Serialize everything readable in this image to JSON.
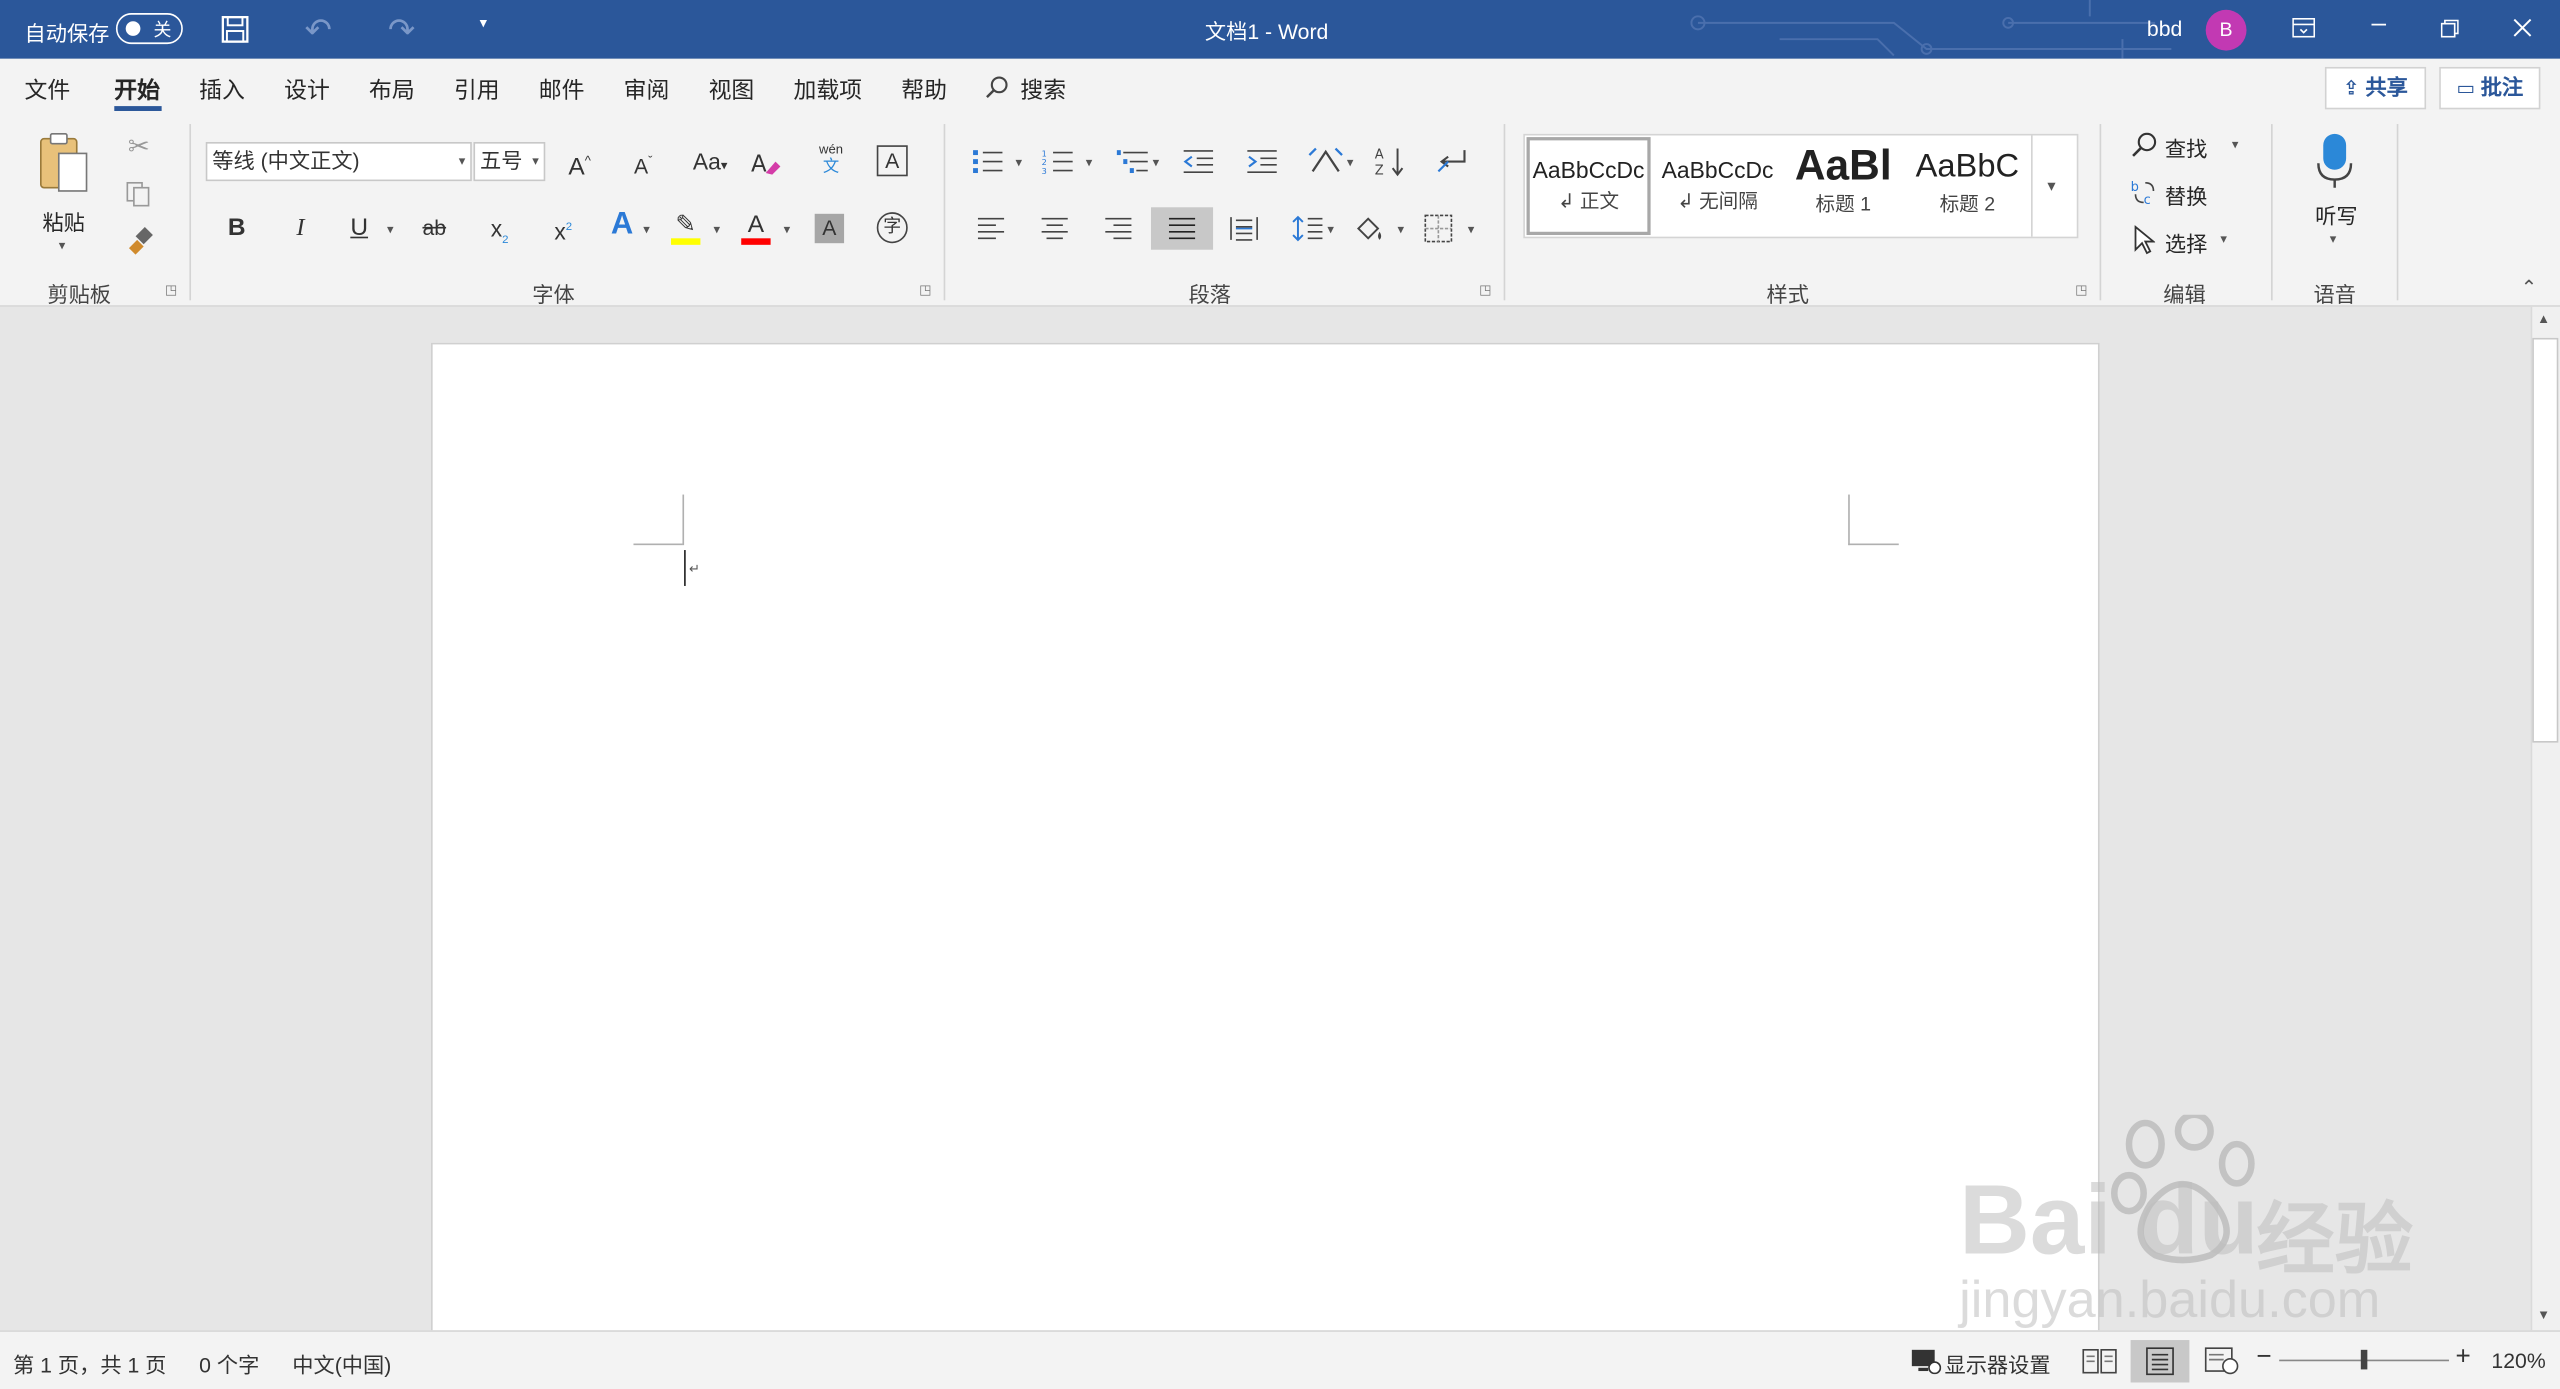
{
  "titlebar": {
    "autosave_label": "自动保存",
    "autosave_state": "关",
    "doc_title": "文档1  -  Word",
    "user_name": "bbd",
    "avatar_initial": "B",
    "icons": [
      "save-icon",
      "undo-icon",
      "redo-icon",
      "customize-qat-icon",
      "ribbon-display-icon",
      "minimize-icon",
      "restore-icon",
      "close-icon"
    ]
  },
  "tabs": {
    "items": [
      "文件",
      "开始",
      "插入",
      "设计",
      "布局",
      "引用",
      "邮件",
      "审阅",
      "视图",
      "加载项",
      "帮助"
    ],
    "active": "开始",
    "search_label": "搜索",
    "share_label": "共享",
    "comments_label": "批注"
  },
  "ribbon": {
    "clipboard": {
      "paste_label": "粘贴",
      "group_label": "剪贴板"
    },
    "font": {
      "font_name": "等线 (中文正文)",
      "font_size": "五号",
      "group_label": "字体",
      "grow_font": "A",
      "shrink_font": "A",
      "change_case": "Aa",
      "phonetic_top": "wén",
      "phonetic_bottom": "文",
      "char_border": "A",
      "bold": "B",
      "italic": "I",
      "underline": "U",
      "strike": "ab",
      "subscript": "x",
      "superscript": "x",
      "text_effect": "A",
      "font_color": "A",
      "char_shading": "A",
      "enclose_char": "字"
    },
    "paragraph": {
      "group_label": "段落"
    },
    "styles": {
      "group_label": "样式",
      "items": [
        {
          "preview": "AaBbCcDc",
          "name": "正文"
        },
        {
          "preview": "AaBbCcDc",
          "name": "无间隔"
        },
        {
          "preview": "AaBl",
          "name": "标题 1"
        },
        {
          "preview": "AaBbC",
          "name": "标题 2"
        }
      ]
    },
    "editing": {
      "find_label": "查找",
      "replace_label": "替换",
      "select_label": "选择",
      "group_label": "编辑"
    },
    "voice": {
      "dictate_label": "听写",
      "group_label": "语音"
    }
  },
  "statusbar": {
    "page_info": "第 1 页，共 1 页",
    "word_count": "0 个字",
    "language": "中文(中国)",
    "display_settings": "显示器设置",
    "zoom_level": "120%",
    "zoom_minus": "−",
    "zoom_plus": "+",
    "zoom_fraction": 0.5
  },
  "watermark": {
    "brand": "Bai  du",
    "brand_cn": "经验",
    "url": "jingyan.baidu.com"
  },
  "colors": {
    "title_bar": "#2b579a",
    "avatar": "#c239b3",
    "highlight": "#ffff00",
    "font_color": "#ff0000"
  }
}
